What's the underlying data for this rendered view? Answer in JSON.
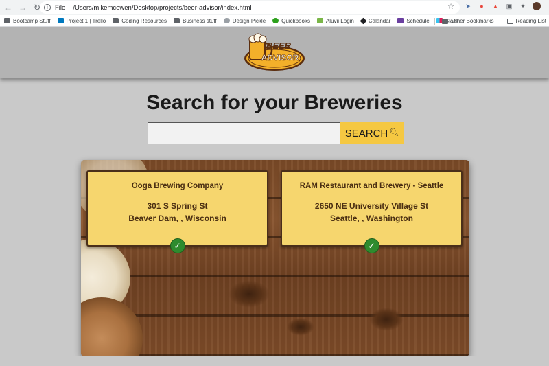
{
  "browser": {
    "scheme": "File",
    "url": "/Users/mikemcewen/Desktop/projects/beer-advisor/index.html",
    "bookmarks": [
      {
        "label": "Bootcamp Stuff",
        "icon": "folder-icon"
      },
      {
        "label": "Project 1 | Trello",
        "icon": "trello-icon"
      },
      {
        "label": "Coding Resources",
        "icon": "folder-icon"
      },
      {
        "label": "Business stuff",
        "icon": "folder-icon"
      },
      {
        "label": "Design Pickle",
        "icon": "design-pickle-icon"
      },
      {
        "label": "Quickbooks",
        "icon": "quickbooks-icon"
      },
      {
        "label": "Aluvii Login",
        "icon": "aluvii-icon"
      },
      {
        "label": "Calandar",
        "icon": "calendar-icon"
      },
      {
        "label": "Schedule",
        "icon": "schedule-icon"
      },
      {
        "label": "Slack",
        "icon": "slack-icon"
      }
    ],
    "overflow": "»",
    "other_bookmarks": "Other Bookmarks",
    "reading_list": "Reading List"
  },
  "logo": {
    "line1": "BEER",
    "line2": "ADVISOR"
  },
  "page": {
    "title": "Search for your Breweries",
    "search_value": "",
    "search_button": "SEARCH"
  },
  "results": [
    {
      "name": "Ooga Brewing Company",
      "street": "301 S Spring St",
      "city": "Beaver Dam, , Wisconsin"
    },
    {
      "name": "RAM Restaurant and Brewery - Seattle",
      "street": "2650 NE University Village St",
      "city": "Seattle, , Washington"
    }
  ],
  "colors": {
    "accent": "#f5c842",
    "card": "#f6d66e",
    "check": "#2e8b2e",
    "header": "#b3b3b3"
  }
}
